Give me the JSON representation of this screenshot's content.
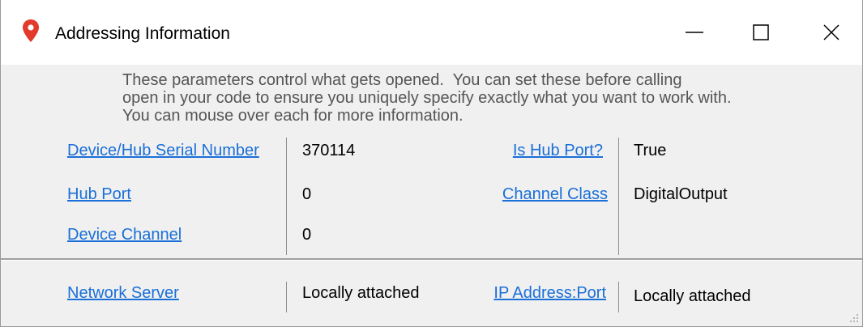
{
  "window": {
    "title": "Addressing Information",
    "icon": "location-pin-icon",
    "accent_icon_color": "#e23b2b",
    "link_color": "#1a6fd8",
    "controls": [
      "minimize-icon",
      "maximize-icon",
      "close-icon"
    ]
  },
  "description": {
    "line1": "These parameters control what gets opened.  You can set these before calling",
    "line2": "open in your code to ensure you uniquely specify exactly what you want to work with.",
    "line3": "You can mouse over each for more information."
  },
  "fields": {
    "serial_number": {
      "label": "Device/Hub Serial Number",
      "value": "370114"
    },
    "hub_port": {
      "label": "Hub Port",
      "value": "0"
    },
    "device_channel": {
      "label": "Device Channel",
      "value": "0"
    },
    "is_hub_port": {
      "label": "Is Hub Port?",
      "value": "True"
    },
    "channel_class": {
      "label": "Channel Class",
      "value": "DigitalOutput"
    }
  },
  "network": {
    "server": {
      "label": "Network Server",
      "value": "Locally attached"
    },
    "ip_address": {
      "label": "IP Address:Port",
      "value": "Locally attached"
    }
  }
}
